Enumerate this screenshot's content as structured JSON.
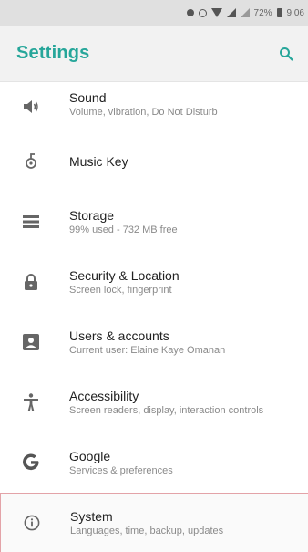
{
  "status_bar": {
    "battery_text": "72%",
    "time": "9:06"
  },
  "app_bar": {
    "title": "Settings",
    "accent_color": "#26a69a",
    "search_icon": "search-icon"
  },
  "items": [
    {
      "id": "sound",
      "icon": "speaker-icon",
      "title": "Sound",
      "subtitle": "Volume, vibration, Do Not Disturb"
    },
    {
      "id": "music-key",
      "icon": "music-key-icon",
      "title": "Music Key",
      "subtitle": ""
    },
    {
      "id": "storage",
      "icon": "storage-icon",
      "title": "Storage",
      "subtitle": "99% used - 732 MB free"
    },
    {
      "id": "security-location",
      "icon": "lock-icon",
      "title": "Security & Location",
      "subtitle": "Screen lock, fingerprint"
    },
    {
      "id": "users-accounts",
      "icon": "account-box-icon",
      "title": "Users & accounts",
      "subtitle": "Current user: Elaine Kaye Omanan"
    },
    {
      "id": "accessibility",
      "icon": "accessibility-icon",
      "title": "Accessibility",
      "subtitle": "Screen readers, display, interaction controls"
    },
    {
      "id": "google",
      "icon": "google-icon",
      "title": "Google",
      "subtitle": "Services & preferences"
    },
    {
      "id": "system",
      "icon": "info-icon",
      "title": "System",
      "subtitle": "Languages, time, backup, updates"
    }
  ]
}
